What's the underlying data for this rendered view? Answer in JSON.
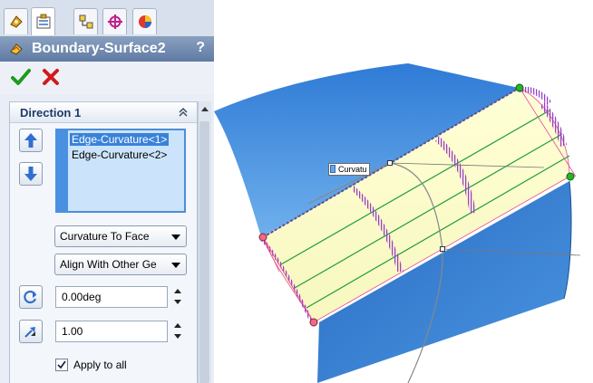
{
  "feature": {
    "title": "Boundary-Surface2",
    "help": "?"
  },
  "manager_tabs": [
    {
      "icon": "feature-tree-icon"
    },
    {
      "icon": "property-manager-icon"
    },
    {
      "icon": "configuration-manager-icon"
    },
    {
      "icon": "dimxpert-manager-icon"
    },
    {
      "icon": "display-manager-icon"
    }
  ],
  "direction1": {
    "title": "Direction 1",
    "curves": [
      "Edge-Curvature<1>",
      "Edge-Curvature<2>"
    ],
    "tangent_type": "Curvature To Face",
    "alignment": "Align With Other Ge",
    "draft_angle": "0.00deg",
    "tangent_influence": "1.00",
    "apply_to_all_label": "Apply to all",
    "apply_to_all_checked": true
  },
  "viewport": {
    "callout_label": "Curvatu"
  },
  "colors": {
    "surface_blue": "#3f86d6",
    "face_yellow": "#ffffcc",
    "curvature_comb": "#9a3fc8",
    "accent_green": "#1d9a1d"
  }
}
